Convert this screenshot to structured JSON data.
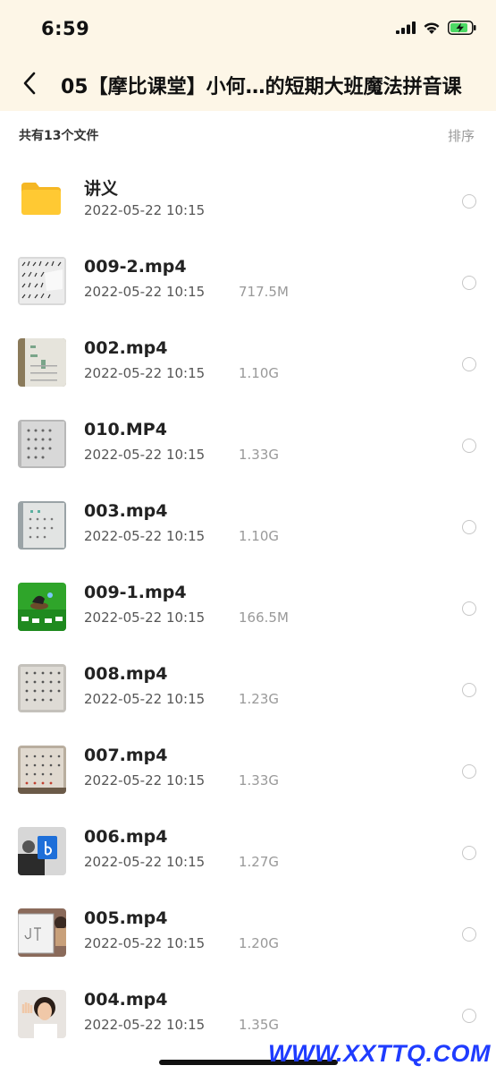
{
  "status_bar": {
    "time": "6:59",
    "icons": [
      "signal-icon",
      "wifi-icon",
      "battery-charging-icon"
    ],
    "battery_color": "#4cd964"
  },
  "nav": {
    "back_icon": "chevron-left-icon",
    "title": "05【摩比课堂】小何…的短期大班魔法拼音课"
  },
  "summary": {
    "count_text": "共有13个文件",
    "sort_label": "排序"
  },
  "files": [
    {
      "name": "讲义",
      "date": "2022-05-22 10:15",
      "size": "",
      "type": "folder",
      "icon": "folder-icon"
    },
    {
      "name": "009-2.mp4",
      "date": "2022-05-22 10:15",
      "size": "717.5M",
      "type": "video",
      "icon": "video-thumbnail"
    },
    {
      "name": "002.mp4",
      "date": "2022-05-22 10:15",
      "size": "1.10G",
      "type": "video",
      "icon": "video-thumbnail"
    },
    {
      "name": "010.MP4",
      "date": "2022-05-22 10:15",
      "size": "1.33G",
      "type": "video",
      "icon": "video-thumbnail"
    },
    {
      "name": "003.mp4",
      "date": "2022-05-22 10:15",
      "size": "1.10G",
      "type": "video",
      "icon": "video-thumbnail"
    },
    {
      "name": "009-1.mp4",
      "date": "2022-05-22 10:15",
      "size": "166.5M",
      "type": "video",
      "icon": "video-thumbnail"
    },
    {
      "name": "008.mp4",
      "date": "2022-05-22 10:15",
      "size": "1.23G",
      "type": "video",
      "icon": "video-thumbnail"
    },
    {
      "name": "007.mp4",
      "date": "2022-05-22 10:15",
      "size": "1.33G",
      "type": "video",
      "icon": "video-thumbnail"
    },
    {
      "name": "006.mp4",
      "date": "2022-05-22 10:15",
      "size": "1.27G",
      "type": "video",
      "icon": "video-thumbnail"
    },
    {
      "name": "005.mp4",
      "date": "2022-05-22 10:15",
      "size": "1.20G",
      "type": "video",
      "icon": "video-thumbnail"
    },
    {
      "name": "004.mp4",
      "date": "2022-05-22 10:15",
      "size": "1.35G",
      "type": "video",
      "icon": "video-thumbnail"
    }
  ],
  "watermark": "WWW.XXTTQ.COM",
  "colors": {
    "header_bg": "#fdf6e7",
    "folder_yellow": "#ffc933",
    "watermark_blue": "#1f3cff"
  }
}
